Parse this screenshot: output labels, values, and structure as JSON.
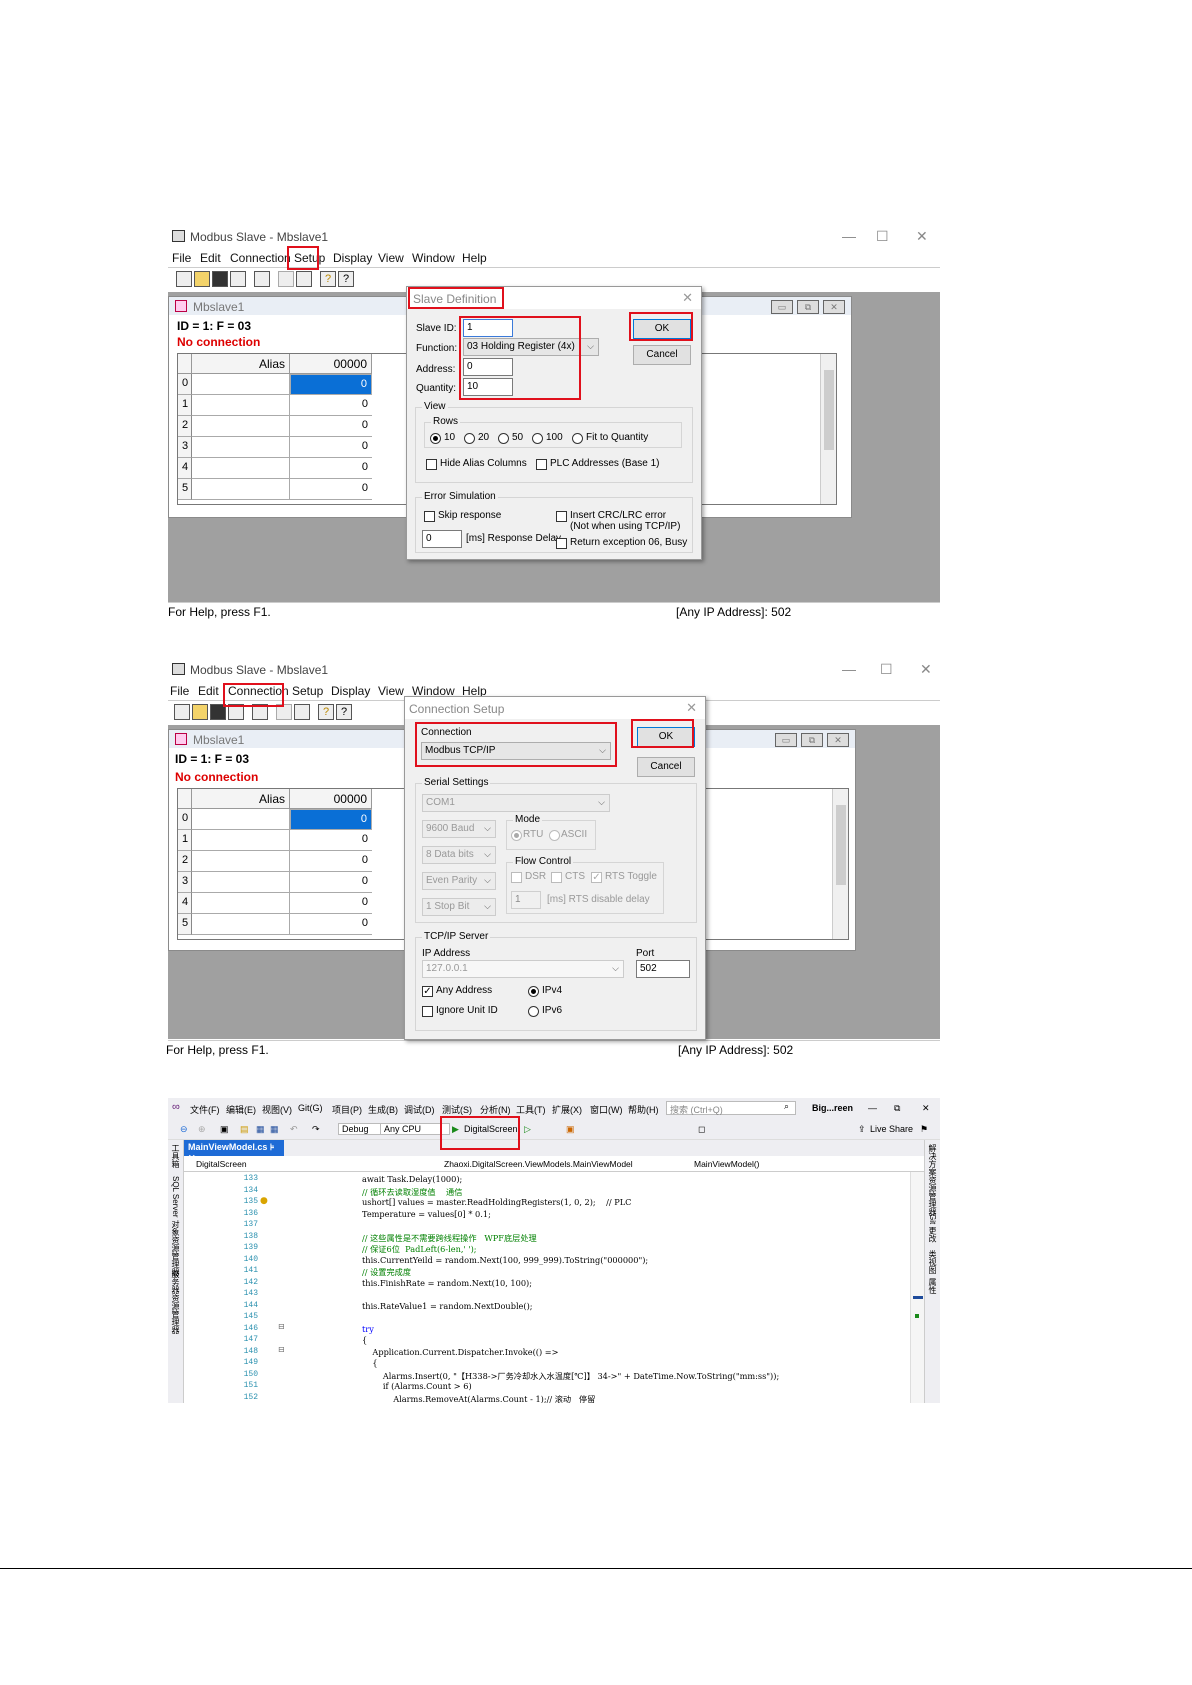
{
  "screen1": {
    "title": "Modbus Slave - Mbslave1",
    "menu": [
      "File",
      "Edit",
      "Connection",
      "Setup",
      "Display",
      "View",
      "Window",
      "Help"
    ],
    "child_title": "Mbslave1",
    "id_line": "ID = 1: F = 03",
    "status": "No connection",
    "grid": {
      "alias_header": "Alias",
      "value_header": "00000",
      "rows": [
        "0",
        "1",
        "2",
        "3",
        "4",
        "5"
      ],
      "values": [
        "0",
        "0",
        "0",
        "0",
        "0",
        "0"
      ]
    },
    "statusbar_left": "For Help, press F1.",
    "statusbar_right": "[Any IP Address]: 502",
    "dialog": {
      "title": "Slave Definition",
      "slave_id_label": "Slave ID:",
      "slave_id": "1",
      "function_label": "Function:",
      "function": "03 Holding Register (4x)",
      "address_label": "Address:",
      "address": "0",
      "quantity_label": "Quantity:",
      "quantity": "10",
      "ok": "OK",
      "cancel": "Cancel",
      "view_group": "View",
      "rows_label": "Rows",
      "row_options": [
        "10",
        "20",
        "50",
        "100",
        "Fit to Quantity"
      ],
      "hide_alias": "Hide Alias Columns",
      "plc_addresses": "PLC Addresses (Base 1)",
      "error_group": "Error Simulation",
      "skip_response": "Skip response",
      "insert_crc": "Insert CRC/LRC error",
      "insert_crc_note": "(Not when using TCP/IP)",
      "response_delay_value": "0",
      "response_delay_label": "[ms] Response Delay",
      "return_exception": "Return exception 06, Busy"
    }
  },
  "screen2": {
    "title": "Modbus Slave - Mbslave1",
    "menu": [
      "File",
      "Edit",
      "Connection",
      "Setup",
      "Display",
      "View",
      "Window",
      "Help"
    ],
    "child_title": "Mbslave1",
    "id_line": "ID = 1: F = 03",
    "status": "No connection",
    "grid": {
      "alias_header": "Alias",
      "value_header": "00000",
      "rows": [
        "0",
        "1",
        "2",
        "3",
        "4",
        "5"
      ],
      "values": [
        "0",
        "0",
        "0",
        "0",
        "0",
        "0"
      ]
    },
    "statusbar_left": "For Help, press F1.",
    "statusbar_right": "[Any IP Address]: 502",
    "dialog": {
      "title": "Connection Setup",
      "connection_group": "Connection",
      "connection": "Modbus TCP/IP",
      "ok": "OK",
      "cancel": "Cancel",
      "serial_group": "Serial Settings",
      "port": "COM1",
      "baud": "9600 Baud",
      "data_bits": "8 Data bits",
      "parity": "Even Parity",
      "stop_bit": "1 Stop Bit",
      "mode_group": "Mode",
      "mode_rtu": "RTU",
      "mode_ascii": "ASCII",
      "flow_group": "Flow Control",
      "dsr": "DSR",
      "cts": "CTS",
      "rts_toggle": "RTS Toggle",
      "rts_delay_value": "1",
      "rts_delay_label": "[ms] RTS disable delay",
      "tcp_group": "TCP/IP Server",
      "ip_label": "IP Address",
      "ip": "127.0.0.1",
      "port_label": "Port",
      "port_value": "502",
      "any_address": "Any Address",
      "ipv4": "IPv4",
      "ignore_unit": "Ignore Unit ID",
      "ipv6": "IPv6"
    }
  },
  "screen3": {
    "menu": [
      "文件(F)",
      "编辑(E)",
      "视图(V)",
      "Git(G)",
      "项目(P)",
      "生成(B)",
      "调试(D)",
      "测试(S)",
      "分析(N)",
      "工具(T)",
      "扩展(X)",
      "窗口(W)",
      "帮助(H)"
    ],
    "search_placeholder": "搜索 (Ctrl+Q)",
    "solution_name": "Big...reen",
    "config": "Debug",
    "platform": "Any CPU",
    "run_target": "DigitalScreen",
    "live_share": "Live Share",
    "tab": "MainViewModel.cs",
    "nav_project": "DigitalScreen",
    "nav_class": "Zhaoxi.DigitalScreen.ViewModels.MainViewModel",
    "nav_member": "MainViewModel()",
    "left_panels": [
      "工具箱",
      "SQL Server 对象资源管理器",
      "服务器资源管理器"
    ],
    "right_panels": [
      "解决方案资源管理器",
      "Git 更改",
      "属性",
      "类视图"
    ],
    "line_numbers": [
      "133",
      "134",
      "135",
      "136",
      "137",
      "138",
      "139",
      "140",
      "141",
      "142",
      "143",
      "144",
      "145",
      "146",
      "147",
      "148",
      "149",
      "150",
      "151",
      "152"
    ],
    "code": [
      "await Task.Delay(1000);",
      "// 循环去读取湿度值    通信",
      "ushort[] values = master.ReadHoldingRegisters(1, 0, 2);    // PLC",
      "Temperature = values[0] * 0.1;",
      "",
      "// 这些属性是不需要跨线程操作   WPF底层处理",
      "// 保证6位  PadLeft(6-len,' ');",
      "this.CurrentYeild = random.Next(100, 999_999).ToString(\"000000\");",
      "// 设置完成度",
      "this.FinishRate = random.Next(10, 100);",
      "",
      "this.RateValue1 = random.NextDouble();",
      "",
      "try",
      "{",
      "    Application.Current.Dispatcher.Invoke(() =>",
      "    {",
      "        Alarms.Insert(0, \"【H338->厂务冷却水入水温度[℃]】 34->\" + DateTime.Now.ToString(\"mm:ss\"));",
      "        if (Alarms.Count > 6)",
      "            Alarms.RemoveAt(Alarms.Count - 1);// 滚动   停留"
    ]
  },
  "colors": {
    "highlight": "#e0101c",
    "selection": "#0a6fd6",
    "vs_tab": "#1e6bd6"
  }
}
